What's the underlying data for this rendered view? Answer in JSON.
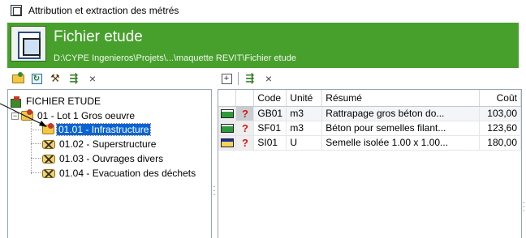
{
  "window": {
    "title": "Attribution et extraction des métrés"
  },
  "banner": {
    "heading": "Fichier etude",
    "path": "D:\\CYPE Ingenieros\\Projets\\...\\maquette REVIT\\Fichier etude",
    "color": "#47a02c"
  },
  "left_toolbar": [
    {
      "icon": "open-folder-icon"
    },
    {
      "icon": "refresh-icon"
    },
    {
      "icon": "tree-structure-icon"
    },
    {
      "icon": "link-icon"
    },
    {
      "icon": "close-icon",
      "glyph": "×"
    }
  ],
  "right_toolbar": [
    {
      "icon": "add-icon",
      "glyph": "+"
    },
    {
      "icon": "link-icon"
    },
    {
      "icon": "close-icon",
      "glyph": "×"
    }
  ],
  "tree": {
    "root": "FICHIER ETUDE",
    "chapter": "01 - Lot 1 Gros oeuvre",
    "items": [
      {
        "label": "01.01 - Infrastructure",
        "selected": true
      },
      {
        "label": "01.02 - Superstructure",
        "selected": false
      },
      {
        "label": "01.03 - Ouvrages divers",
        "selected": false
      },
      {
        "label": "01.04 - Evacuation des déchets",
        "selected": false
      }
    ]
  },
  "grid": {
    "columns": {
      "code": "Code",
      "unit": "Unité",
      "summary": "Résumé",
      "cost": "Coût"
    },
    "rows": [
      {
        "status": "green",
        "flag": "?",
        "code": "GB01",
        "unit": "m3",
        "summary": "Rattrapage gros béton do...",
        "cost": "103,00",
        "selected": true
      },
      {
        "status": "green",
        "flag": "?",
        "code": "SF01",
        "unit": "m3",
        "summary": "Béton pour semelles filant...",
        "cost": "123,60",
        "selected": false
      },
      {
        "status": "yellow",
        "flag": "?",
        "code": "SI01",
        "unit": "U",
        "summary": "Semelle isolée 1.00 x 1.00...",
        "cost": "180,00",
        "selected": false
      }
    ]
  },
  "colors": {
    "selection": "#0a63d1",
    "flag": "#d11a0c"
  }
}
